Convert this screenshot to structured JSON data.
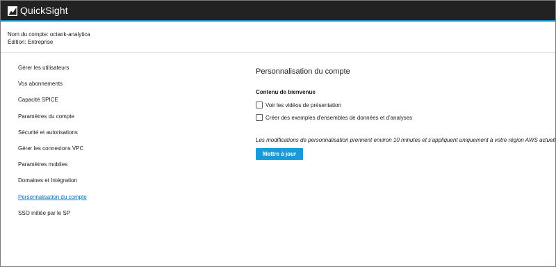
{
  "app": {
    "name": "QuickSight",
    "icon": "quicksight-logo-icon"
  },
  "colors": {
    "topbar_bg": "#222222",
    "topbar_accent": "#1a8ec7",
    "link_active": "#0073bb",
    "primary_button": "#1a9ad6"
  },
  "account": {
    "name_line": "Nom du compte: octank-analytica",
    "edition_line": "Édition: Entreprise"
  },
  "sidebar": {
    "items": [
      {
        "label": "Gérer les utilisateurs"
      },
      {
        "label": "Vos abonnements"
      },
      {
        "label": "Capacité SPICE"
      },
      {
        "label": "Paramètres du compte"
      },
      {
        "label": "Sécurité et autorisations"
      },
      {
        "label": "Gérer les connexions VPC"
      },
      {
        "label": "Paramètres mobiles"
      },
      {
        "label": "Domaines et Intégration"
      },
      {
        "label": "Personnalisation du compte",
        "active": true
      },
      {
        "label": "SSO initiée par le SP"
      }
    ]
  },
  "main": {
    "title": "Personnalisation du compte",
    "section_title": "Contenu de bienvenue",
    "options": [
      {
        "label": "Voir les vidéos de présentation",
        "checked": false
      },
      {
        "label": "Créer des exemples d'ensembles de données et d'analyses",
        "checked": false
      }
    ],
    "note": "Les modifications de personnalisation prennent environ 10 minutes et s'appliquent uniquement à votre région AWS actuelle.",
    "update_button": "Mettre à jour"
  }
}
